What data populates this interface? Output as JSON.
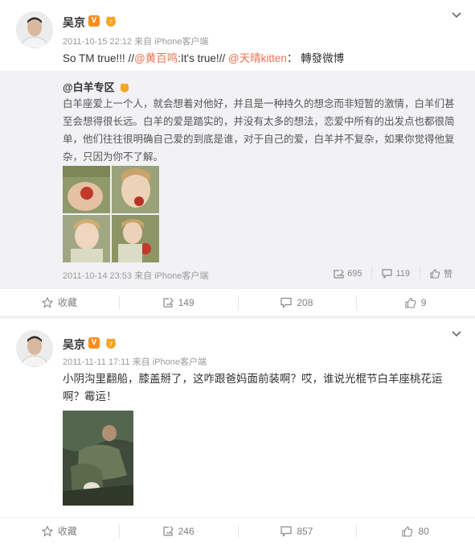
{
  "posts": [
    {
      "author": "吴京",
      "time_source": "2011-10-15 22:12 来自 iPhone客户端",
      "text_plain": "So TM true!!! //",
      "mention1": "@黄百鸣",
      "text_mid": ":It's true!// ",
      "mention2": "@天晴kitten",
      "text_end": "： 轉發微博",
      "repost": {
        "author": "@白羊专区",
        "text": "白羊座爱上一个人，就会想着对他好，并且是一种持久的想念而非短暂的激情，白羊们甚至会想得很长远。白羊的爱是踏实的，并没有太多的想法，恋爱中所有的出发点也都很简单，他们往往很明确自己爱的到底是谁，对于自己的爱，白羊并不复杂，如果你觉得他复杂，只因为你不了解。",
        "time_source": "2011-10-14 23:53 来自 iPhone客户端",
        "reposts": "695",
        "comments": "119",
        "likes": "赞"
      },
      "actions": {
        "favorite": "收藏",
        "reposts": "149",
        "comments": "208",
        "likes": "9"
      }
    },
    {
      "author": "吴京",
      "time_source": "2011-11-11 17:11 来自 iPhone客户端",
      "text": "小阴沟里翻船，膝盖掰了，这咋跟爸妈面前装啊？哎，谁说光棍节白羊座桃花运啊？霉运！",
      "actions": {
        "favorite": "收藏",
        "reposts": "246",
        "comments": "857",
        "likes": "80"
      }
    }
  ],
  "colors": {
    "mention": "#eb7350",
    "verified": "#f78e1e",
    "meta": "#999999",
    "repost_bg": "#f2f2f5"
  },
  "icons": [
    "chevron-down-icon",
    "verified-icon",
    "vip-icon",
    "star-icon",
    "repost-icon",
    "comment-icon",
    "like-icon"
  ]
}
